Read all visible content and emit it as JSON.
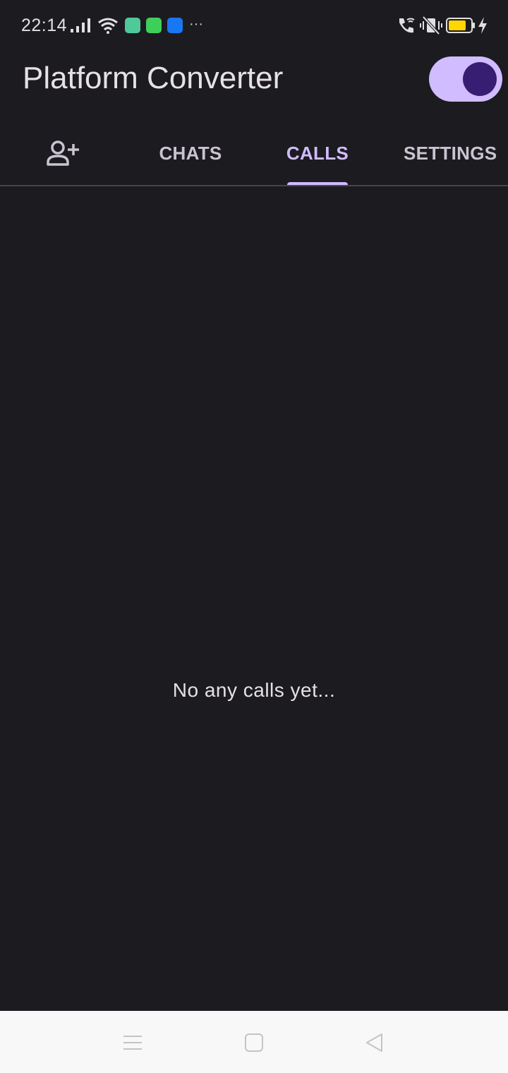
{
  "status_bar": {
    "time": "22:14",
    "icons": [
      "signal-icon",
      "wifi-icon",
      "app-badge-icon",
      "message-badge-icon",
      "usb-badge-icon",
      "more-icon",
      "wifi-call-icon",
      "vibrate-off-icon",
      "battery-icon",
      "charging-icon"
    ],
    "more": "···",
    "battery_color": "#ffd600"
  },
  "app_bar": {
    "title": "Platform Converter",
    "toggle_on": true,
    "accent": "#d0bcff"
  },
  "tabs": [
    {
      "label": "",
      "icon": "add-person-icon"
    },
    {
      "label": "CHATS"
    },
    {
      "label": "CALLS",
      "selected": true
    },
    {
      "label": "SETTINGS"
    }
  ],
  "empty_state": {
    "message": "No any calls yet..."
  },
  "nav_bar": {
    "buttons": [
      "menu-icon",
      "home-icon",
      "back-icon"
    ]
  }
}
